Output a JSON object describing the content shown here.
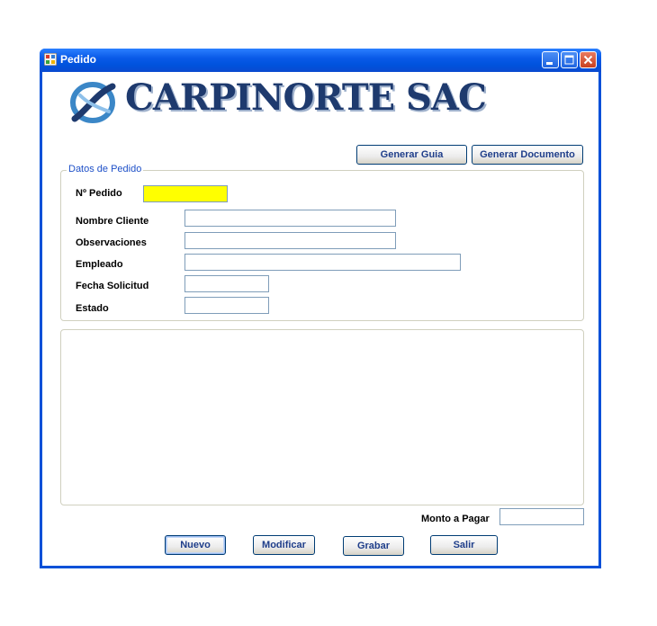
{
  "window": {
    "title": "Pedido",
    "colors": {
      "titlebar": "#0a5ae8",
      "field_highlight": "#ffff00"
    }
  },
  "logo": {
    "text": "CARPINORTE SAC"
  },
  "toolbar": {
    "generar_guia": "Generar Guia",
    "generar_documento": "Generar Documento"
  },
  "datos_pedido": {
    "title": "Datos de Pedido",
    "labels": {
      "numero_pedido": "Nº Pedido",
      "nombre_cliente": "Nombre Cliente",
      "observaciones": "Observaciones",
      "empleado": "Empleado",
      "fecha_solicitud": "Fecha Solicitud",
      "estado": "Estado"
    },
    "values": {
      "numero_pedido": "",
      "nombre_cliente": "",
      "observaciones": "",
      "empleado": "",
      "fecha_solicitud": "",
      "estado": ""
    }
  },
  "monto": {
    "label": "Monto a Pagar",
    "value": ""
  },
  "actions": {
    "nuevo": "Nuevo",
    "modificar": "Modificar",
    "grabar": "Grabar",
    "salir": "Salir"
  },
  "icons": [
    "app-icon",
    "minimize-icon",
    "maximize-icon",
    "close-icon",
    "logo-icon"
  ]
}
